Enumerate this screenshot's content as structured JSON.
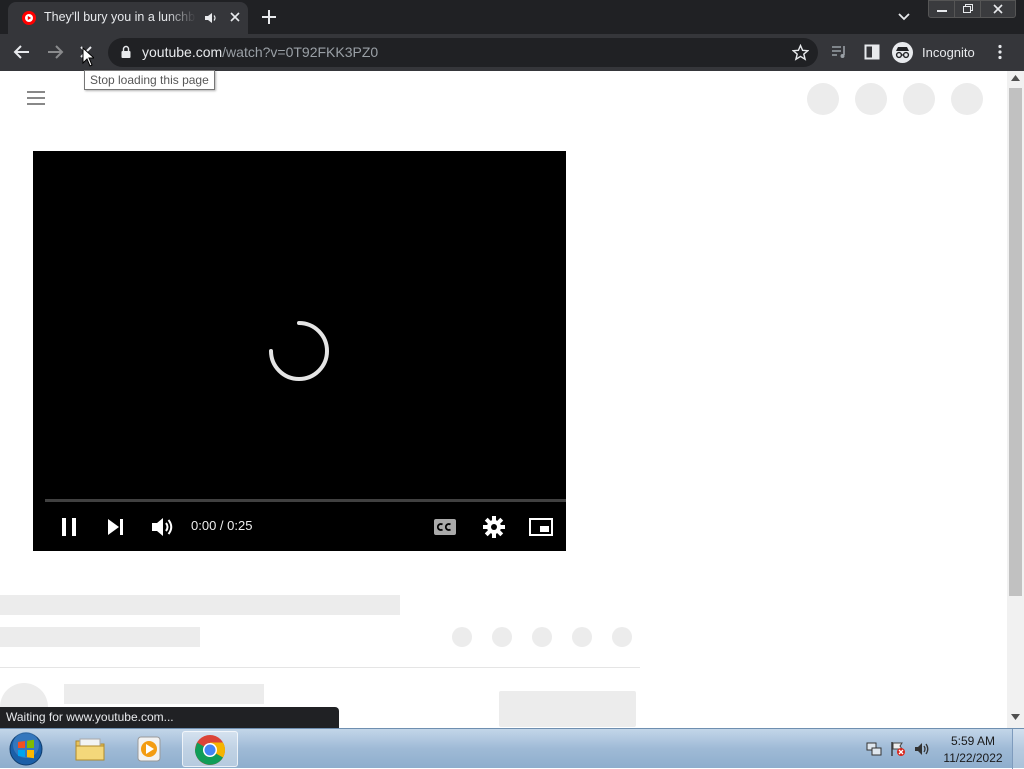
{
  "browser": {
    "tab": {
      "title": "They'll bury you in a lunchbox",
      "favicon": "youtube-favicon",
      "audio_icon": "speaker-icon"
    },
    "new_tab_icon": "plus-icon",
    "tab_search_icon": "chevron-down-icon",
    "window_controls": [
      "minimize-icon",
      "restore-icon",
      "close-icon"
    ],
    "toolbar": {
      "back_icon": "arrow-left-icon",
      "forward_icon": "arrow-right-icon",
      "stop_icon": "close-icon",
      "url_host": "youtube.com",
      "url_path": "/watch?v=0T92FKK3PZ0",
      "incognito_label": "Incognito"
    },
    "tooltip": "Stop loading this page",
    "status": "Waiting for www.youtube.com..."
  },
  "player": {
    "time": "0:00 / 0:25",
    "state": "loading",
    "progress": 0
  },
  "taskbar": {
    "items": [
      "windows-explorer",
      "windows-media-player",
      "google-chrome"
    ],
    "active": "google-chrome",
    "clock": {
      "time": "5:59 AM",
      "date": "11/22/2022"
    }
  },
  "colors": {
    "chrome_dark": "#202124",
    "toolbar": "#35363a",
    "youtube_red": "#ff0000",
    "skeleton": "#ececec"
  }
}
